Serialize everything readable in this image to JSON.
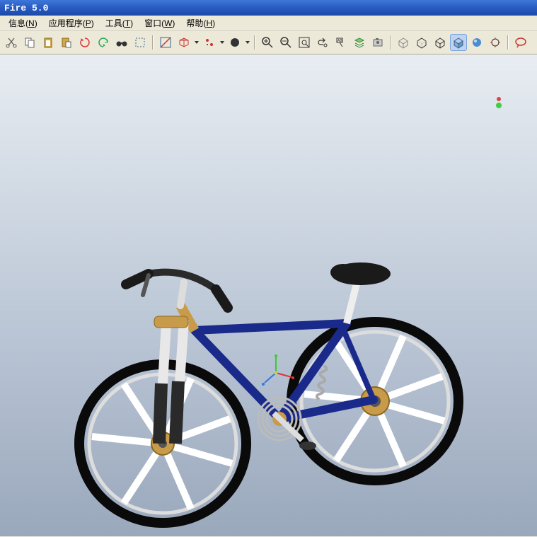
{
  "title": "Fire 5.0",
  "menu": {
    "info": {
      "label": "信息",
      "shortcut": "N"
    },
    "app": {
      "label": "应用程序",
      "shortcut": "P"
    },
    "tools": {
      "label": "工具",
      "shortcut": "T"
    },
    "window": {
      "label": "窗口",
      "shortcut": "W"
    },
    "help": {
      "label": "帮助",
      "shortcut": "H"
    }
  },
  "toolbar_icons": {
    "group1": [
      "cut-icon",
      "copy-icon",
      "paste-icon",
      "paste-special-icon",
      "regenerate-icon",
      "undo-icon",
      "binoculars-icon",
      "select-icon"
    ],
    "group2": [
      "axis-display-icon",
      "datum-plane-icon",
      "point-display-icon",
      "coord-sys-icon"
    ],
    "group3": [
      "zoom-in-icon",
      "zoom-out-icon",
      "fit-window-icon",
      "redraw-icon",
      "annotate-icon",
      "layers-icon",
      "camera-icon"
    ],
    "group4": [
      "wireframe-icon",
      "hidden-line-icon",
      "no-hidden-icon",
      "shaded-edges-icon",
      "shaded-icon",
      "view-orient-icon"
    ],
    "group5": [
      "annotate2-icon"
    ]
  },
  "colors": {
    "titlebar": "#2a5bc1",
    "menu_bg": "#ece9d8",
    "viewport_top": "#e8edf2",
    "viewport_bottom": "#9aa8bc"
  },
  "model": {
    "name": "bicycle",
    "frame_color": "#1a2a8a",
    "tires_color": "#0a0a0a",
    "seat_color": "#1a1a1a",
    "spokes_color": "#ffffff"
  }
}
